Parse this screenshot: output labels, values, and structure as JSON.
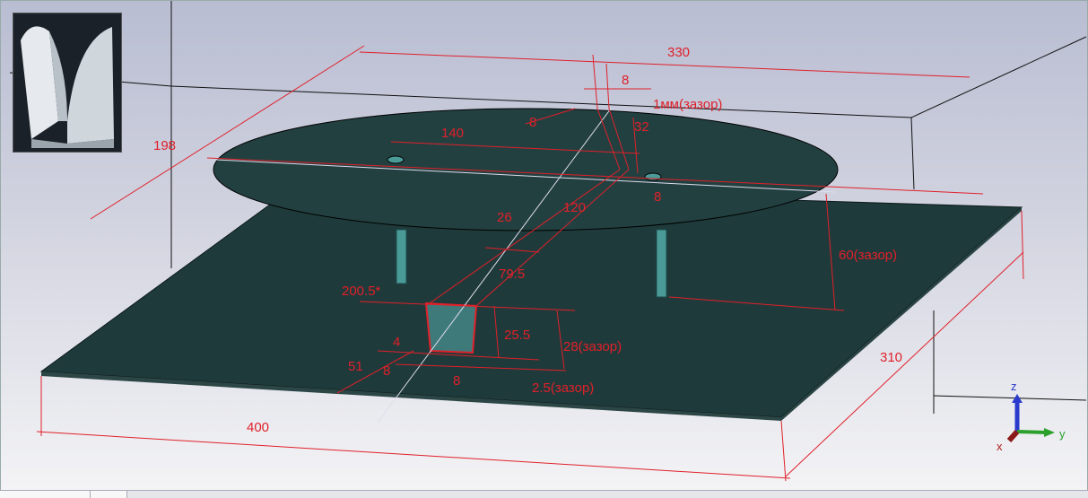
{
  "window": {
    "title": "3D view"
  },
  "dimensions": {
    "d330": "330",
    "d8_top": "8",
    "d1mm": "1мм(зазор)",
    "d8_left": "8",
    "d32": "32",
    "d140": "140",
    "d198": "198",
    "d8_post": "8",
    "d120": "120",
    "d26": "26",
    "d79_5": "79.5",
    "d60": "60(зазор)",
    "d200_5": "200.5*",
    "d25_5": "25.5",
    "d28": "28(зазор)",
    "d4": "4",
    "d51": "51",
    "d8_a": "8",
    "d8_b": "8",
    "d2_5": "2.5(зазор)",
    "d310": "310",
    "d400": "400"
  },
  "axes": {
    "z": "z",
    "y": "y",
    "x": "x"
  },
  "colors": {
    "ground": "#1f3a3a",
    "dim": "#e0202a",
    "post": "#4a9a98"
  }
}
